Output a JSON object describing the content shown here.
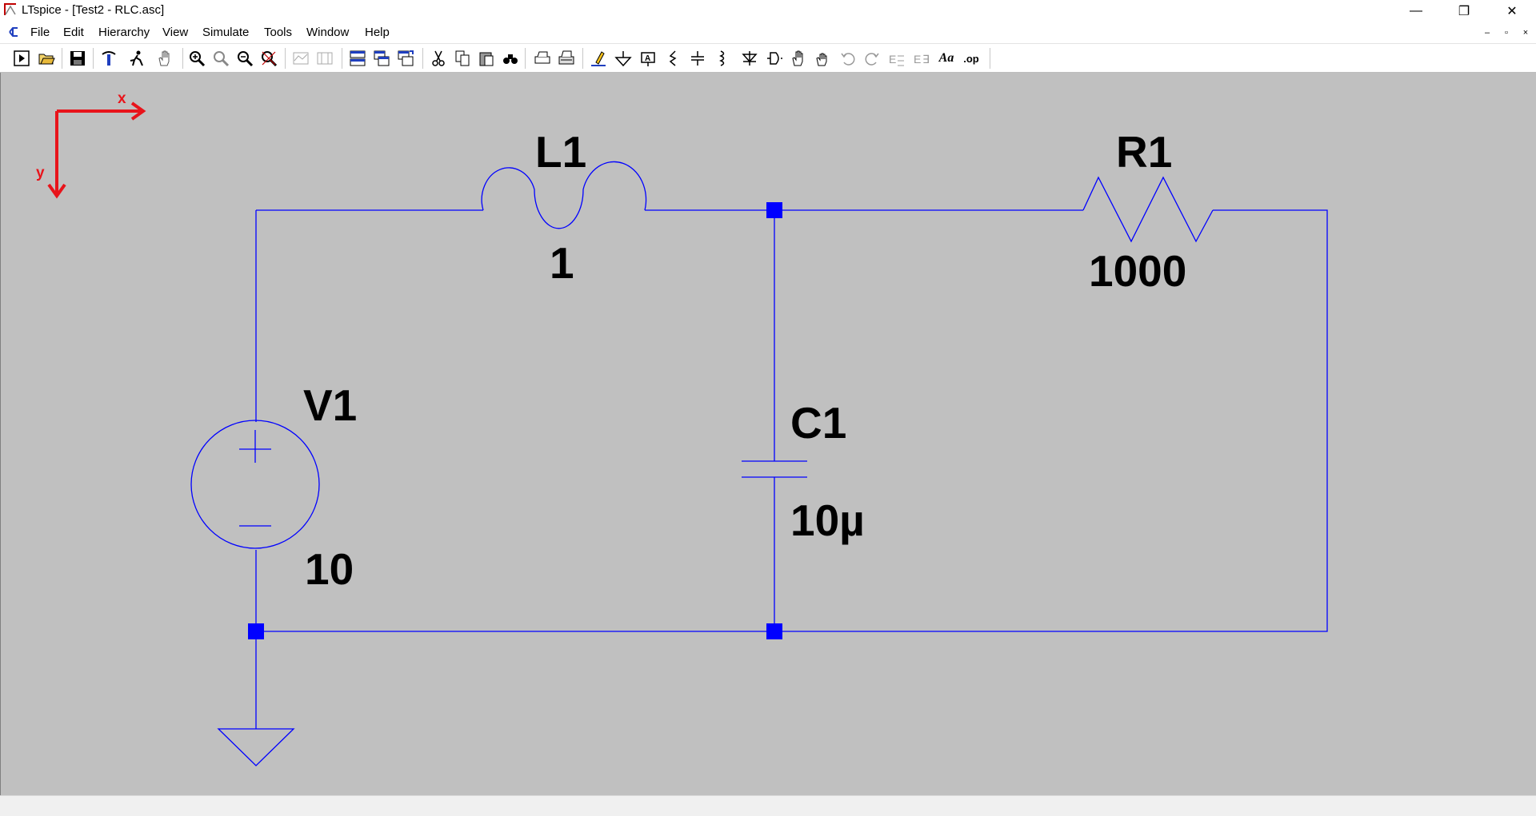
{
  "window": {
    "title": "LTspice - [Test2 - RLC.asc]",
    "controls": {
      "minimize": "—",
      "restore": "❐",
      "close": "✕"
    }
  },
  "menu": {
    "items": [
      "File",
      "Edit",
      "Hierarchy",
      "View",
      "Simulate",
      "Tools",
      "Window",
      "Help"
    ],
    "mdi_controls": {
      "minimize": "–",
      "restore": "▫",
      "close": "×"
    }
  },
  "toolbar": {
    "tools": [
      "run-icon",
      "open-icon",
      "save-icon",
      "control-panel-icon",
      "halt-icon",
      "pan-icon",
      "zoom-in-icon",
      "zoom-area-icon",
      "zoom-out-icon",
      "zoom-fit-icon",
      "autorange-icon",
      "mark-range-icon",
      "tile-horizontal-icon",
      "cascade-icon",
      "tile-vertical-icon",
      "cut-icon",
      "copy-icon",
      "paste-icon",
      "find-icon",
      "print-icon",
      "print-preview-icon",
      "draw-wire-icon",
      "ground-icon",
      "label-net-icon",
      "resistor-icon",
      "capacitor-icon",
      "inductor-icon",
      "diode-icon",
      "component-icon",
      "move-icon",
      "drag-icon",
      "undo-icon",
      "redo-icon",
      "rotate-icon",
      "mirror-icon",
      "text-icon",
      "spice-directive-icon"
    ],
    "text_text": "Aa",
    "directive_text": ".op"
  },
  "axes": {
    "x_label": "x",
    "y_label": "y",
    "color": "#e8141b"
  },
  "schematic": {
    "wire_color": "#0000ff",
    "node_color": "#0000ff",
    "components": {
      "V1": {
        "name": "V1",
        "value": "10"
      },
      "L1": {
        "name": "L1",
        "value": "1"
      },
      "C1": {
        "name": "C1",
        "value": "10µ"
      },
      "R1": {
        "name": "R1",
        "value": "1000"
      }
    }
  }
}
